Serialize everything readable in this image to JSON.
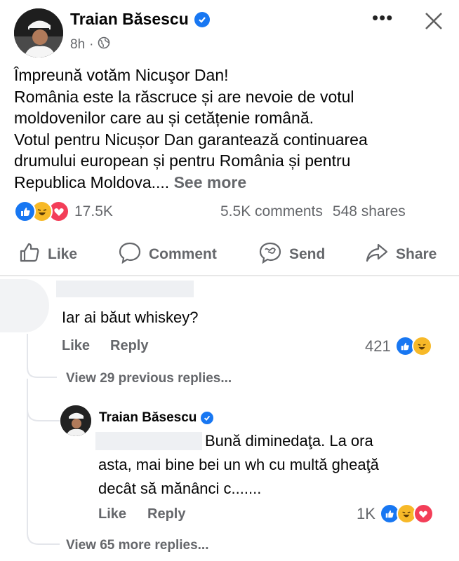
{
  "post": {
    "author": "Traian Băsescu",
    "time": "8h",
    "time_separator": "·",
    "lines": [
      "Împreună votăm Nicuşor Dan!",
      "România este la răscruce și are nevoie de votul",
      "moldovenilor care au și cetățenie română.",
      "Votul pentru Nicușor Dan garantează continuarea",
      "drumului european și pentru România și pentru",
      "Republica Moldova...."
    ],
    "see_more": "See more",
    "reaction_count": "17.5K",
    "comments": "5.5K comments",
    "shares": "548 shares"
  },
  "actions": {
    "like": "Like",
    "comment": "Comment",
    "send": "Send",
    "share": "Share"
  },
  "comment1": {
    "text": "Iar ai băut whiskey?",
    "like": "Like",
    "reply": "Reply",
    "reaction_count": "421"
  },
  "view_previous": "View 29 previous replies...",
  "reply1": {
    "author": "Traian Băsescu",
    "line1": "Bună diminedaţa. La ora",
    "line2": "asta, mai bine bei un wh cu multă gheaţă",
    "line3": "decât să mănânci c.......",
    "like": "Like",
    "reply": "Reply",
    "reaction_count": "1K"
  },
  "view_more": "View 65 more replies...",
  "colors": {
    "like_blue": "#1877f2",
    "love_red": "#f33e58",
    "haha_yellow": "#f7b928",
    "meta_gray": "#65676b"
  }
}
